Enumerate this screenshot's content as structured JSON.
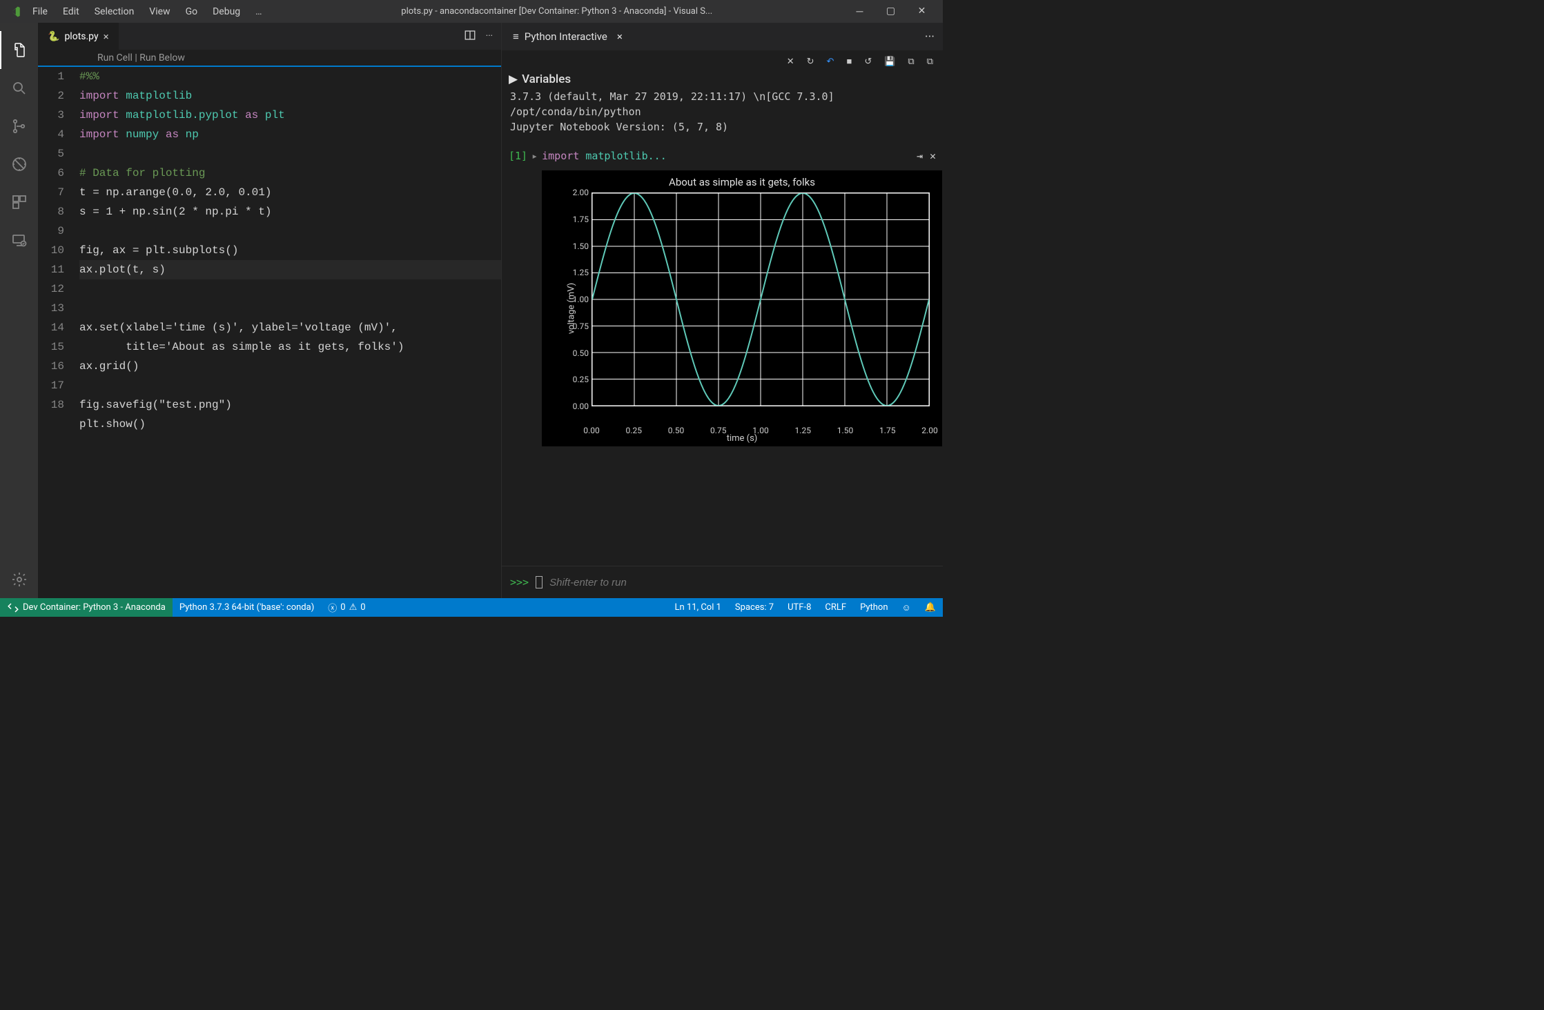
{
  "menu": {
    "file": "File",
    "edit": "Edit",
    "selection": "Selection",
    "view": "View",
    "go": "Go",
    "debug": "Debug",
    "more": "…"
  },
  "window_title": "plots.py - anacondacontainer [Dev Container: Python 3 - Anaconda] - Visual S...",
  "tab": {
    "filename": "plots.py"
  },
  "codelens": {
    "runcell": "Run Cell",
    "runbelow": "Run Below"
  },
  "code": {
    "l1": "#%%",
    "l2a": "import",
    "l2b": "matplotlib",
    "l3a": "import",
    "l3b": "matplotlib.pyplot",
    "l3c": "as",
    "l3d": "plt",
    "l4a": "import",
    "l4b": "numpy",
    "l4c": "as",
    "l4d": "np",
    "l6": "# Data for plotting",
    "l7": "t = np.arange(0.0, 2.0, 0.01)",
    "l8": "s = 1 + np.sin(2 * np.pi * t)",
    "l10": "fig, ax = plt.subplots()",
    "l11": "ax.plot(t, s)",
    "l13": "ax.set(xlabel='time (s)', ylabel='voltage (mV)',",
    "l14": "       title='About as simple as it gets, folks')",
    "l15": "ax.grid()",
    "l17": "fig.savefig(\"test.png\")",
    "l18": "plt.show()"
  },
  "line_numbers": [
    "1",
    "2",
    "3",
    "4",
    "5",
    "6",
    "7",
    "8",
    "9",
    "10",
    "11",
    "12",
    "13",
    "14",
    "15",
    "16",
    "17",
    "18"
  ],
  "interactive": {
    "title": "Python Interactive",
    "variables": "Variables",
    "info": "3.7.3 (default, Mar 27 2019, 22:11:17) \\n[GCC 7.3.0]\n/opt/conda/bin/python\nJupyter Notebook Version: (5, 7, 8)",
    "cell_num": "[1]",
    "cell_code_kw": "import",
    "cell_code_rest": "matplotlib...",
    "repl_prompt": ">>>",
    "repl_placeholder": "Shift-enter to run"
  },
  "chart_data": {
    "type": "line",
    "title": "About as simple as it gets, folks",
    "xlabel": "time (s)",
    "ylabel": "voltage (mV)",
    "xticks": [
      "0.00",
      "0.25",
      "0.50",
      "0.75",
      "1.00",
      "1.25",
      "1.50",
      "1.75",
      "2.00"
    ],
    "yticks": [
      "0.00",
      "0.25",
      "0.50",
      "0.75",
      "1.00",
      "1.25",
      "1.50",
      "1.75",
      "2.00"
    ],
    "xlim": [
      0.0,
      2.0
    ],
    "ylim": [
      0.0,
      2.0
    ],
    "series": [
      {
        "name": "s",
        "formula": "1 + sin(2*pi*t)",
        "x_step": 0.01
      }
    ]
  },
  "status": {
    "remote": "Dev Container: Python 3 - Anaconda",
    "interpreter": "Python 3.7.3 64-bit ('base': conda)",
    "errors": "0",
    "warnings": "0",
    "lncol": "Ln 11, Col 1",
    "spaces": "Spaces: 7",
    "encoding": "UTF-8",
    "eol": "CRLF",
    "language": "Python"
  }
}
